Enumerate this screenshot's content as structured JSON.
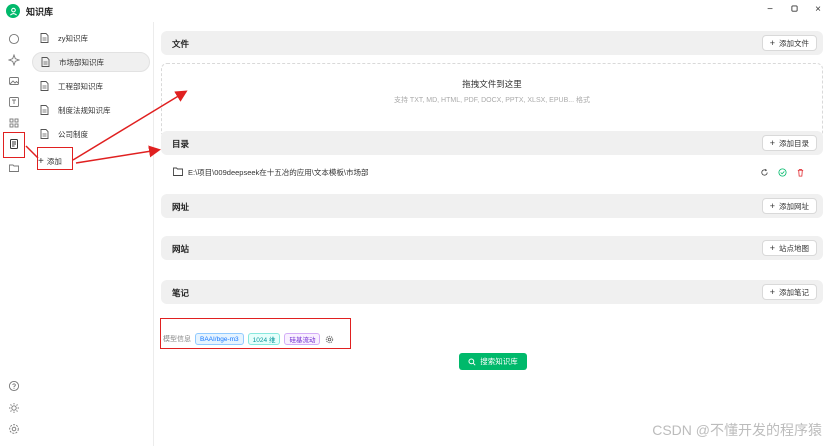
{
  "app": {
    "title": "知识库"
  },
  "window_controls": {
    "minimize": "−",
    "maximize": "▢",
    "close": "×"
  },
  "knowledge_bases": [
    {
      "label": "zy知识库",
      "active": false
    },
    {
      "label": "市场部知识库",
      "active": true
    },
    {
      "label": "工程部知识库",
      "active": false
    },
    {
      "label": "制度法规知识库",
      "active": false
    },
    {
      "label": "公司制度",
      "active": false
    }
  ],
  "add_kb_label": "添加",
  "sections": {
    "files": {
      "title": "文件",
      "button": "添加文件"
    },
    "dropzone": {
      "title": "拖拽文件到这里",
      "subtitle": "支持 TXT, MD, HTML, PDF, DOCX, PPTX, XLSX, EPUB... 格式"
    },
    "directory": {
      "title": "目录",
      "button": "添加目录",
      "path": "E:\\项目\\009deepseek在十五冶的应用\\文本模板\\市场部"
    },
    "url": {
      "title": "网址",
      "button": "添加网址"
    },
    "website": {
      "title": "网站",
      "button": "站点地图"
    },
    "notes": {
      "title": "笔记",
      "button": "添加笔记"
    }
  },
  "model_info": {
    "label": "模型信息",
    "tags": [
      "BAAI/bge-m3",
      "1024 维",
      "硅基流动"
    ]
  },
  "search_button": "搜索知识库",
  "watermark": "CSDN @不懂开发的程序猿",
  "colors": {
    "accent": "#00b96b",
    "highlight": "#e02020"
  }
}
